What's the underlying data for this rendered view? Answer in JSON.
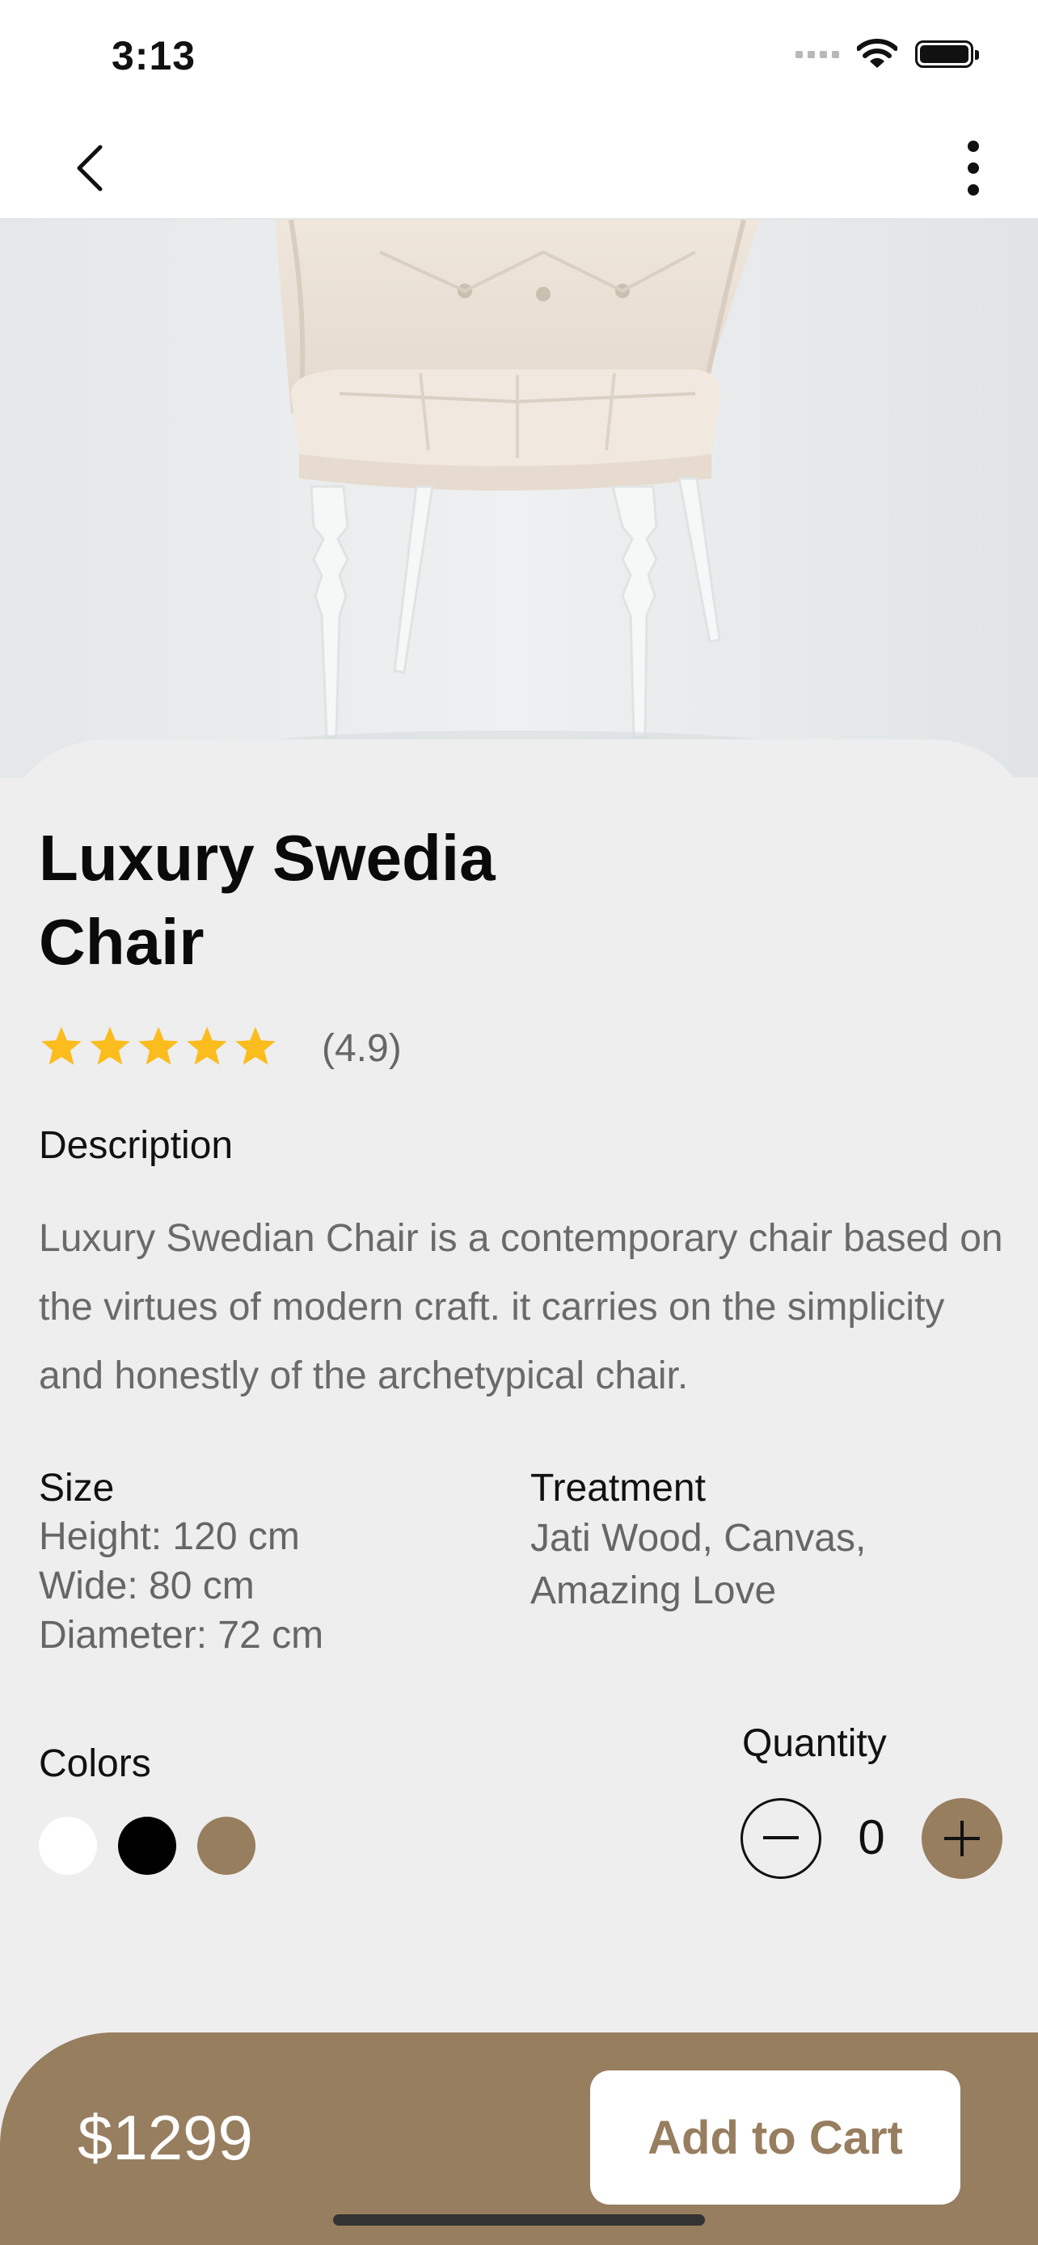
{
  "status_bar": {
    "time": "3:13"
  },
  "nav": {
    "back_icon": "chevron-left-icon",
    "more_icon": "more-vertical-icon"
  },
  "product": {
    "title": "Luxury Swedia Chair",
    "rating": {
      "stars": 5,
      "value": 4.9,
      "label": "(4.9)",
      "star_color": "#fbbc1e"
    },
    "description_heading": "Description",
    "description": "Luxury Swedian Chair is a contemporary chair based on the virtues of modern craft. it carries on the simplicity and honestly of the archetypical chair.",
    "size": {
      "heading": "Size",
      "lines": [
        "Height: 120 cm",
        "Wide: 80 cm",
        "Diameter: 72 cm"
      ]
    },
    "treatment": {
      "heading": "Treatment",
      "lines": [
        "Jati Wood, Canvas,",
        "Amazing Love"
      ]
    },
    "colors": {
      "heading": "Colors",
      "options": [
        "#ffffff",
        "#000000",
        "#977e5f"
      ]
    },
    "quantity": {
      "heading": "Quantity",
      "value": "0"
    }
  },
  "footer": {
    "price": "$1299",
    "add_to_cart_label": "Add to Cart"
  },
  "theme": {
    "accent": "#977e5f",
    "background": "#eeeeee"
  }
}
